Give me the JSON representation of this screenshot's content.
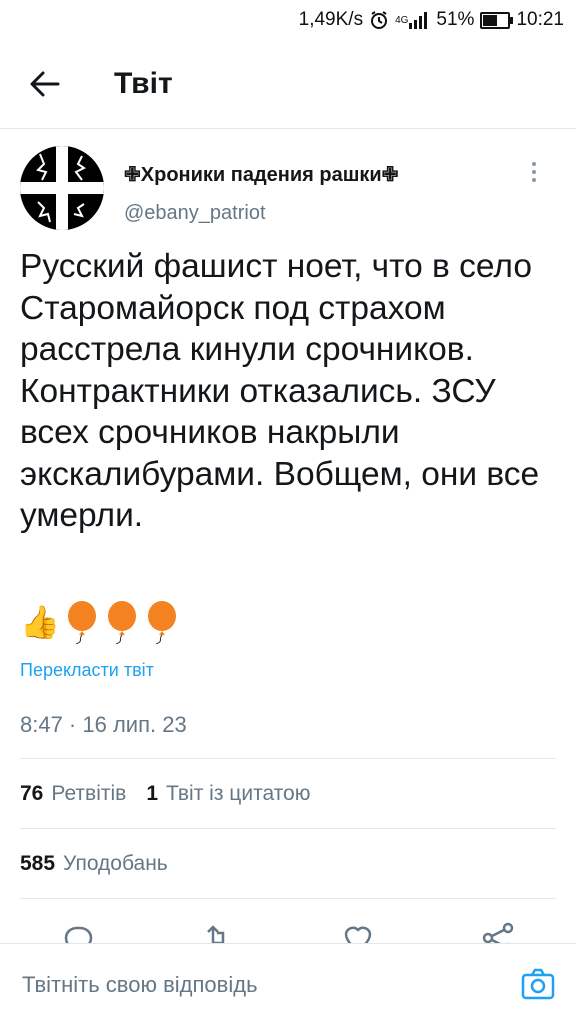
{
  "status_bar": {
    "speed": "1,49K/s",
    "network": "4G",
    "battery": "51%",
    "battery_level": 0.51,
    "time": "10:21"
  },
  "header": {
    "title": "Твіт"
  },
  "tweet": {
    "author_name": "✙Хроники падения рашки✙",
    "author_handle": "@ebany_patriot",
    "text": "Русский фашист ноет, что в село Старомайорск под страхом расстрела кинули срочников. Контрактники отказались. ЗСУ всех срочников накрыли экскалибурами. Вобщем, они все умерли.",
    "emojis": [
      "👍",
      "🎈",
      "🎈",
      "🎈"
    ],
    "translate_label": "Перекласти твіт",
    "timestamp": "8:47 · 16 лип. 23"
  },
  "stats": {
    "retweets_count": "76",
    "retweets_label": "Ретвітів",
    "quotes_count": "1",
    "quotes_label": "Твіт із цитатою",
    "likes_count": "585",
    "likes_label": "Уподобань"
  },
  "actions": [
    "reply-icon",
    "retweet-icon",
    "like-icon",
    "share-icon"
  ],
  "reply_bar": {
    "placeholder": "Твітніть свою відповідь"
  },
  "colors": {
    "accent": "#1da1f2",
    "secondary_text": "#657786",
    "divider": "#e1e8ed"
  }
}
